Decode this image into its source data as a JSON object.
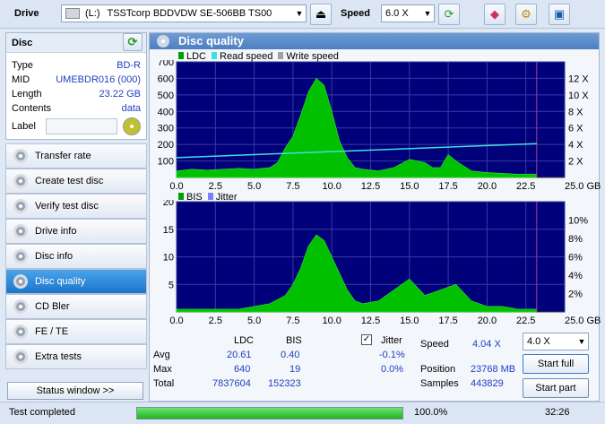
{
  "toolbar": {
    "drive_label": "Drive",
    "drive_letter": "(L:)",
    "drive_value": "TSSTcorp BDDVDW SE-506BB TS00",
    "speed_label": "Speed",
    "speed_value": "6.0 X"
  },
  "disc": {
    "title": "Disc",
    "rows": [
      {
        "label": "Type",
        "value": "BD-R"
      },
      {
        "label": "MID",
        "value": "UMEBDR016 (000)"
      },
      {
        "label": "Length",
        "value": "23.22 GB"
      },
      {
        "label": "Contents",
        "value": "data"
      }
    ],
    "label_field": "Label"
  },
  "nav": [
    {
      "label": "Transfer rate",
      "active": false
    },
    {
      "label": "Create test disc",
      "active": false
    },
    {
      "label": "Verify test disc",
      "active": false
    },
    {
      "label": "Drive info",
      "active": false
    },
    {
      "label": "Disc info",
      "active": false
    },
    {
      "label": "Disc quality",
      "active": true
    },
    {
      "label": "CD Bler",
      "active": false
    },
    {
      "label": "FE / TE",
      "active": false
    },
    {
      "label": "Extra tests",
      "active": false
    }
  ],
  "status_window_button": "Status window >>",
  "main": {
    "title": "Disc quality",
    "top_legend": [
      "LDC",
      "Read speed",
      "Write speed"
    ],
    "bottom_legend": [
      "BIS",
      "Jitter"
    ],
    "colors": {
      "ldc": "#00c000",
      "read": "#40e0e0",
      "write": "#a0a0a0",
      "bis": "#00c000",
      "jitter": "#8080ff",
      "plot_bg": "#00007a"
    }
  },
  "chart_data": [
    {
      "type": "area",
      "x_ticks": [
        "0.0",
        "2.5",
        "5.0",
        "7.5",
        "10.0",
        "12.5",
        "15.0",
        "17.5",
        "20.0",
        "22.5",
        "25.0 GB"
      ],
      "y_left_ticks": [
        "700",
        "600",
        "500",
        "400",
        "300",
        "200",
        "100"
      ],
      "y_right_ticks": [
        "12 X",
        "10 X",
        "8 X",
        "6 X",
        "4 X",
        "2 X"
      ],
      "xlim": [
        0,
        25
      ],
      "ylim": [
        0,
        700
      ],
      "series": [
        {
          "name": "LDC",
          "x": [
            0,
            1,
            2,
            3,
            4,
            5,
            6,
            6.5,
            7,
            7.5,
            8,
            8.5,
            9,
            9.5,
            10,
            10.5,
            11,
            11.5,
            12,
            13,
            14,
            15,
            16,
            16.5,
            17,
            17.5,
            18,
            19,
            20,
            21,
            22,
            23.2
          ],
          "values": [
            40,
            50,
            45,
            50,
            55,
            50,
            60,
            90,
            180,
            250,
            380,
            520,
            600,
            560,
            400,
            220,
            120,
            60,
            50,
            40,
            60,
            110,
            90,
            60,
            60,
            140,
            100,
            40,
            30,
            25,
            20,
            20
          ]
        },
        {
          "name": "Read speed",
          "x": [
            0,
            23.2
          ],
          "values": [
            2.4,
            4.1
          ]
        }
      ]
    },
    {
      "type": "area",
      "x_ticks": [
        "0.0",
        "2.5",
        "5.0",
        "7.5",
        "10.0",
        "12.5",
        "15.0",
        "17.5",
        "20.0",
        "22.5",
        "25.0 GB"
      ],
      "y_left_ticks": [
        "20",
        "15",
        "10",
        "5"
      ],
      "y_right_ticks": [
        "10%",
        "8%",
        "6%",
        "4%",
        "2%"
      ],
      "xlim": [
        0,
        25
      ],
      "ylim": [
        0,
        20
      ],
      "series": [
        {
          "name": "BIS",
          "x": [
            0,
            2,
            4,
            5,
            6,
            7,
            7.5,
            8,
            8.5,
            9,
            9.5,
            10,
            10.5,
            11,
            11.5,
            12,
            13,
            14,
            15,
            16,
            17,
            18,
            19,
            20,
            21,
            22,
            23.2
          ],
          "values": [
            0.5,
            0.5,
            0.5,
            1,
            1.5,
            3,
            5,
            8,
            12,
            14,
            13,
            10,
            7,
            4,
            2,
            1.5,
            2,
            4,
            6,
            3,
            4,
            5,
            2,
            1,
            1,
            0.5,
            0.5
          ]
        }
      ]
    }
  ],
  "stats": {
    "col_ldc": "LDC",
    "col_bis": "BIS",
    "jitter_label": "Jitter",
    "rows": [
      {
        "label": "Avg",
        "ldc": "20.61",
        "bis": "0.40",
        "jitter": "-0.1%"
      },
      {
        "label": "Max",
        "ldc": "640",
        "bis": "19",
        "jitter": "0.0%"
      },
      {
        "label": "Total",
        "ldc": "7837604",
        "bis": "152323",
        "jitter": ""
      }
    ],
    "speed_label": "Speed",
    "speed_value": "4.04 X",
    "position_label": "Position",
    "position_value": "23768 MB",
    "samples_label": "Samples",
    "samples_value": "443829",
    "speed_select": "4.0 X",
    "start_full": "Start full",
    "start_part": "Start part"
  },
  "status": {
    "text": "Test completed",
    "progress": 1.0,
    "percent": "100.0%",
    "time": "32:26"
  }
}
